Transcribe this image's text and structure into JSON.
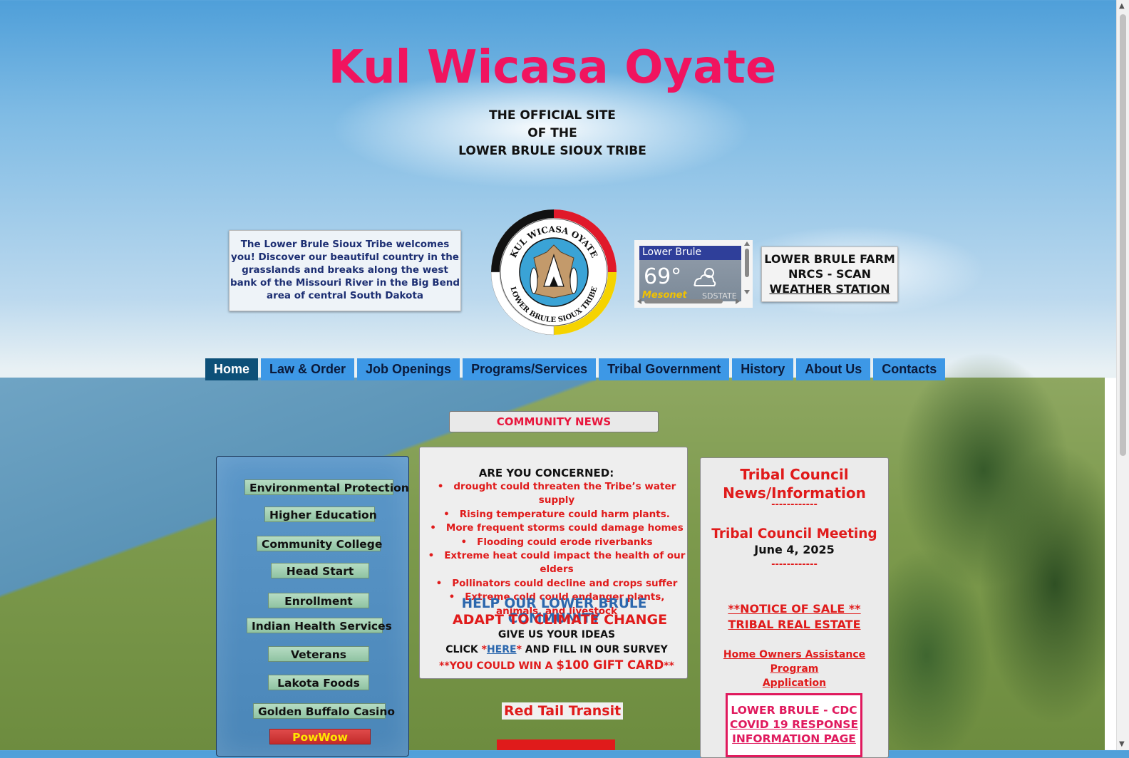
{
  "site": {
    "title": "Kul Wicasa Oyate",
    "subtitle_line1": "THE OFFICIAL SITE",
    "subtitle_line2": "OF THE",
    "subtitle_line3": "LOWER BRULE SIOUX TRIBE"
  },
  "welcome": {
    "text": "The Lower Brule Sioux Tribe welcomes you! Discover our beautiful country in the grasslands and breaks along the west bank of the Missouri River in the Big Bend area of central South Dakota"
  },
  "logo": {
    "top_text": "KUL WICASA OYATE",
    "bottom_text": "LOWER BRULE SIOUX TRIBE",
    "ring_colors": [
      "#111111",
      "#e0192a",
      "#f5d300",
      "#ffffff"
    ]
  },
  "weather": {
    "location": "Lower Brule",
    "temperature": "69°",
    "icon": "partly-cloudy-icon",
    "brand": "Mesonet",
    "brand_suffix": "SDSTATE"
  },
  "farm": {
    "line1": "LOWER BRULE FARM",
    "line2": "NRCS - SCAN",
    "line3": "WEATHER STATION"
  },
  "nav": {
    "items": [
      "Home",
      "Law & Order",
      "Job Openings",
      "Programs/Services",
      "Tribal Government",
      "History",
      "About Us",
      "Contacts"
    ],
    "active": "Home"
  },
  "community_news": {
    "header": "COMMUNITY NEWS"
  },
  "sidebar": {
    "items": [
      "Environmental Protection",
      "Higher Education",
      "Community College",
      "Head Start",
      "Enrollment",
      "Indian Health Services",
      "Veterans",
      "Lakota Foods",
      "Golden Buffalo Casino",
      "PowWow"
    ]
  },
  "climate": {
    "title": "ARE YOU CONCERNED:",
    "concerns": [
      "drought could threaten the Tribe’s water supply",
      "Rising temperature could harm plants.",
      "More frequent storms could damage homes",
      "Flooding could erode riverbanks",
      "Extreme heat could impact the health of our elders",
      "Pollinators could decline and crops suffer",
      "Extreme cold could endanger plants, animals, and livestock"
    ],
    "help_line1": "HELP OUR LOWER BRULE COMMUNITY",
    "help_line2": "ADAPT TO CLIMATE CHANGE",
    "ideas": "GIVE US YOUR IDEAS",
    "click_prefix": "CLICK ",
    "star": "*",
    "here_link": "HERE",
    "click_suffix": " AND FILL IN OUR SURVEY",
    "win_prefix": "**YOU COULD WIN A ",
    "win_amount": "$100 GIFT CARD",
    "win_suffix": "**"
  },
  "red_tail": {
    "label": "Red Tail Transit"
  },
  "council": {
    "title_line1": "Tribal Council",
    "title_line2": "News/Information",
    "dashes": "------------",
    "meeting": "Tribal Council Meeting",
    "date": "June 4, 2025",
    "notice_line1": "**NOTICE OF SALE **",
    "notice_line2": "TRIBAL REAL ESTATE",
    "home_line1": "Home Owners Assistance Program",
    "home_line2": "Application ",
    "cdc_line1": "LOWER BRULE - CDC",
    "cdc_line2": "COVID 19 RESPONSE",
    "cdc_line3": "INFORMATION PAGE"
  }
}
